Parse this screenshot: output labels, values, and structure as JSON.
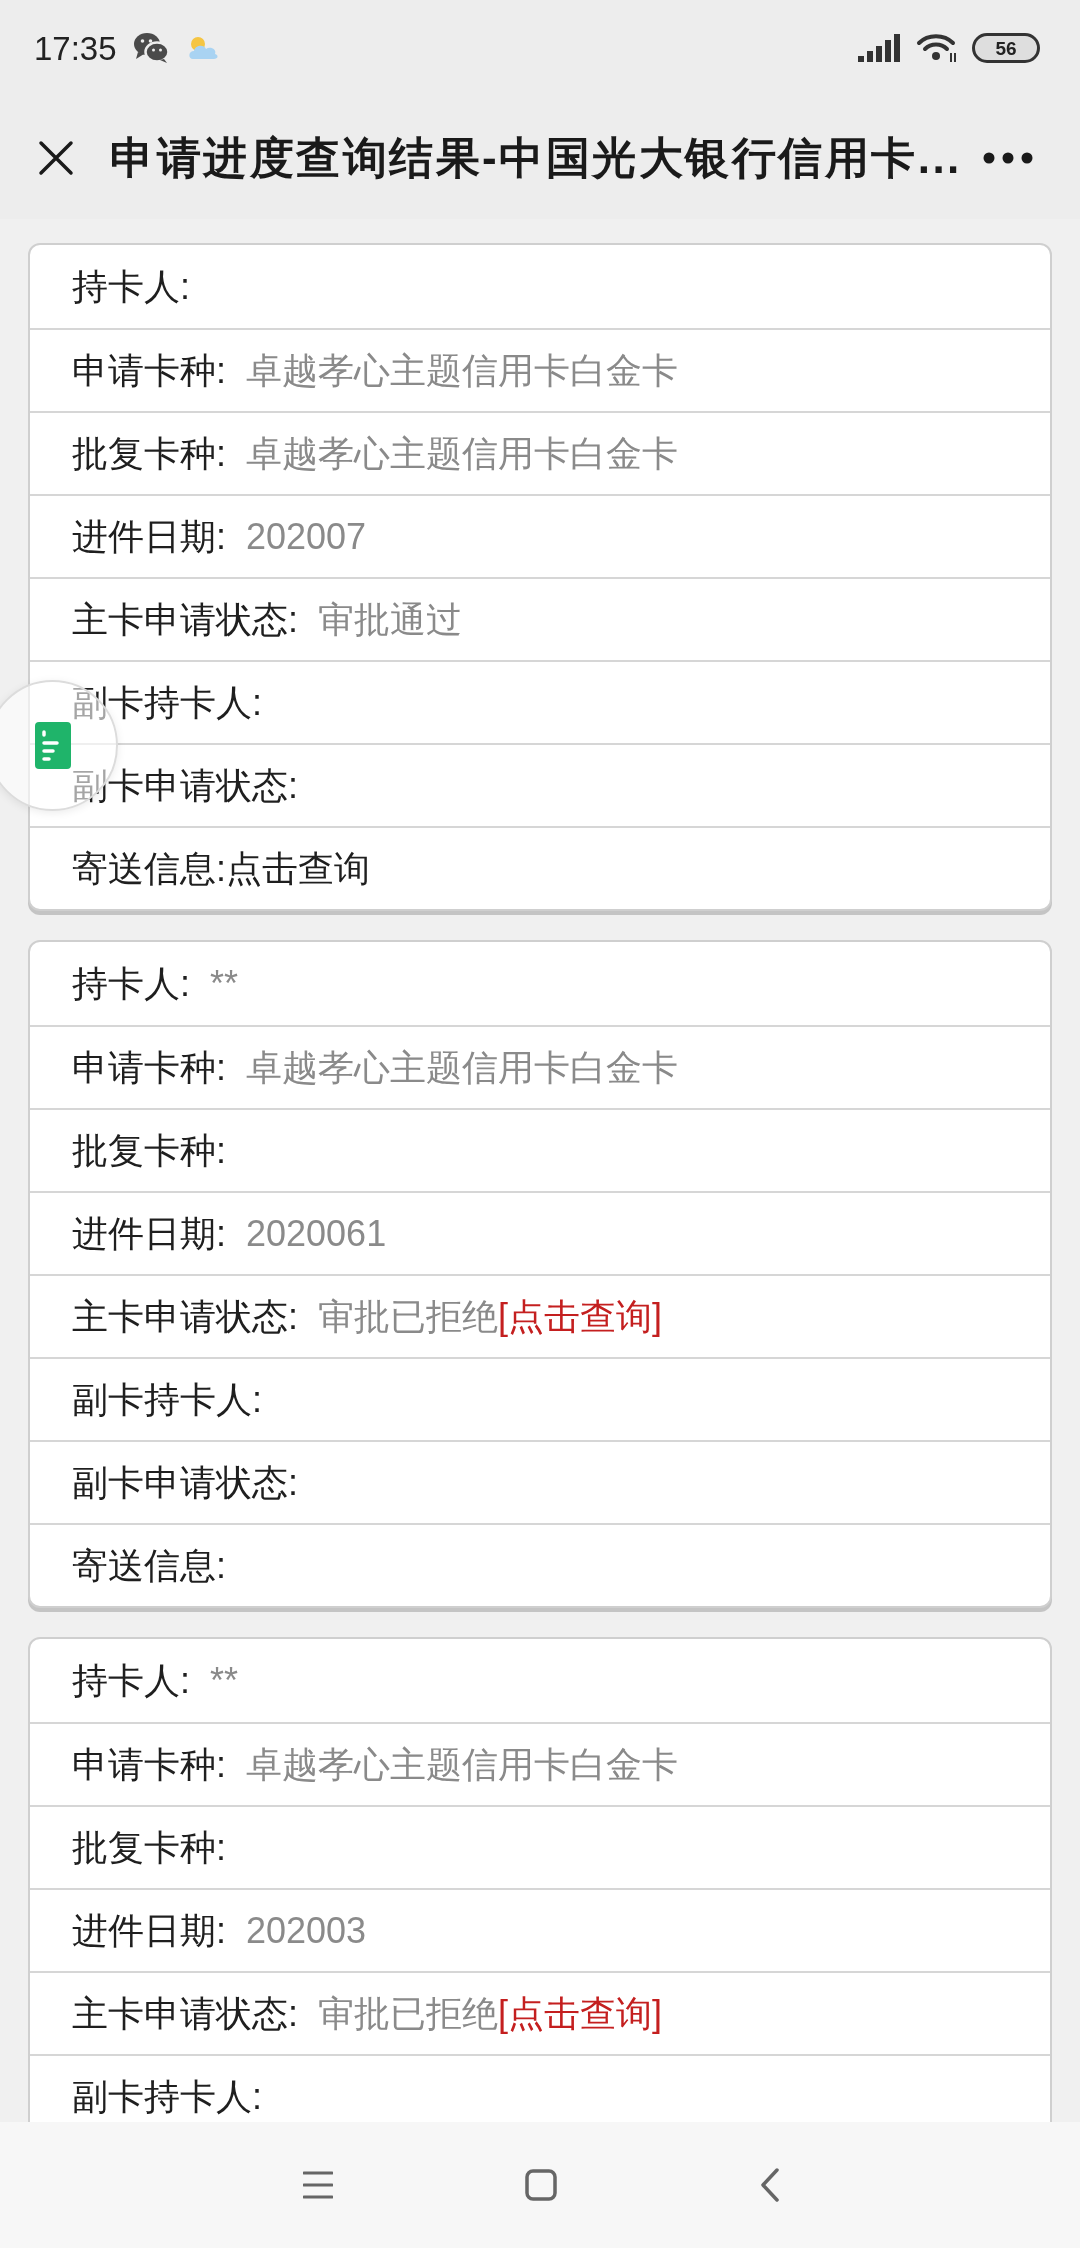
{
  "status_bar": {
    "time": "17:35",
    "battery": "56"
  },
  "header": {
    "title": "申请进度查询结果-中国光大银行信用卡..."
  },
  "cards": [
    {
      "rows": [
        {
          "label": "持卡人:"
        },
        {
          "label": "申请卡种:",
          "value": "卓越孝心主题信用卡白金卡"
        },
        {
          "label": "批复卡种:",
          "value": "卓越孝心主题信用卡白金卡"
        },
        {
          "label": "进件日期:",
          "value": "202007"
        },
        {
          "label": "主卡申请状态:",
          "value": "审批通过"
        },
        {
          "label": "副卡持卡人:"
        },
        {
          "label": "副卡申请状态:"
        },
        {
          "label": "寄送信息:",
          "link": "点击查询"
        }
      ]
    },
    {
      "rows": [
        {
          "label": "持卡人:",
          "value": "**"
        },
        {
          "label": "申请卡种:",
          "value": "卓越孝心主题信用卡白金卡"
        },
        {
          "label": "批复卡种:"
        },
        {
          "label": "进件日期:",
          "value": "2020061"
        },
        {
          "label": "主卡申请状态:",
          "value": "审批已拒绝",
          "action": "[点击查询]"
        },
        {
          "label": "副卡持卡人:"
        },
        {
          "label": "副卡申请状态:"
        },
        {
          "label": "寄送信息:"
        }
      ]
    },
    {
      "rows": [
        {
          "label": "持卡人:",
          "value": "**"
        },
        {
          "label": "申请卡种:",
          "value": "卓越孝心主题信用卡白金卡"
        },
        {
          "label": "批复卡种:"
        },
        {
          "label": "进件日期:",
          "value": "202003"
        },
        {
          "label": "主卡申请状态:",
          "value": "审批已拒绝",
          "action": "[点击查询]"
        },
        {
          "label": "副卡持卡人:"
        }
      ]
    }
  ]
}
